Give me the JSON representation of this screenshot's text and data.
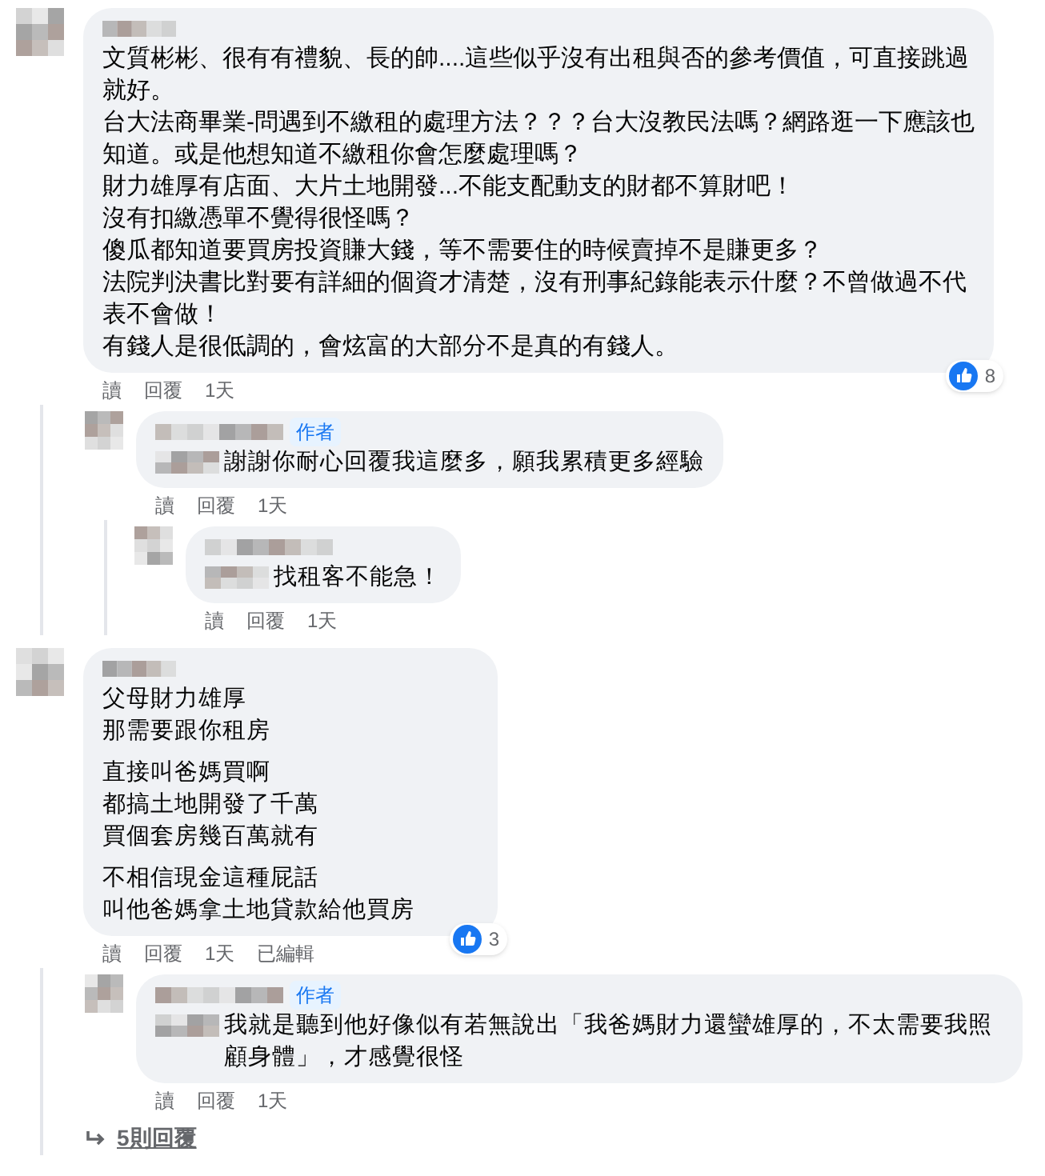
{
  "comments": [
    {
      "lines": [
        "文質彬彬、很有有禮貌、長的帥....這些似乎沒有出租與否的參考價值，可直接跳過就好。",
        "台大法商畢業-問遇到不繳租的處理方法？？？台大沒教民法嗎？網路逛一下應該也知道。或是他想知道不繳租你會怎麼處理嗎？",
        "財力雄厚有店面、大片土地開發...不能支配動支的財都不算財吧！",
        "沒有扣繳憑單不覺得很怪嗎？",
        "傻瓜都知道要買房投資賺大錢，等不需要住的時候賣掉不是賺更多？",
        "法院判決書比對要有詳細的個資才清楚，沒有刑事紀錄能表示什麼？不曾做過不代表不會做！",
        "有錢人是很低調的，會炫富的大部分不是真的有錢人。"
      ],
      "actions": [
        "讀",
        "回覆",
        "1天"
      ],
      "reactions": "8",
      "replies": [
        {
          "badge": "作者",
          "lines": [
            "謝謝你耐心回覆我這麼多，願我累積更多經驗"
          ],
          "actions": [
            "讀",
            "回覆",
            "1天"
          ],
          "replies": [
            {
              "lines": [
                "找租客不能急！"
              ],
              "actions": [
                "讀",
                "回覆",
                "1天"
              ]
            }
          ]
        }
      ]
    },
    {
      "paragraphs": [
        [
          "父母財力雄厚",
          "那需要跟你租房"
        ],
        [
          "直接叫爸媽買啊",
          "都搞土地開發了千萬",
          "買個套房幾百萬就有"
        ],
        [
          "不相信現金這種屁話",
          "叫他爸媽拿土地貸款給他買房"
        ]
      ],
      "actions": [
        "讀",
        "回覆",
        "1天",
        "已編輯"
      ],
      "reactions": "3",
      "replies": [
        {
          "badge": "作者",
          "lines": [
            "我就是聽到他好像似有若無說出「我爸媽財力還蠻雄厚的，不太需要我照顧身體」，才感覺很怪"
          ],
          "actions": [
            "讀",
            "回覆",
            "1天"
          ]
        }
      ],
      "more_replies": "5則回覆"
    }
  ]
}
